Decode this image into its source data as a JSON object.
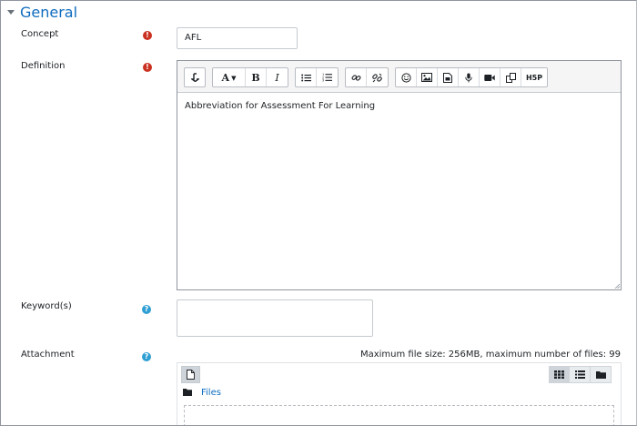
{
  "section": {
    "title": "General"
  },
  "fields": {
    "concept": {
      "label": "Concept",
      "value": "AFL"
    },
    "definition": {
      "label": "Definition",
      "content": "Abbreviation for Assessment For Learning"
    },
    "keywords": {
      "label": "Keyword(s)",
      "value": ""
    },
    "attachment": {
      "label": "Attachment",
      "max_info": "Maximum file size: 256MB, maximum number of files: 99",
      "path_label": "Files"
    }
  },
  "editor_toolbar": {
    "h5p_label": "H5P"
  },
  "colors": {
    "link_blue": "#0f6cbf",
    "required_red": "#ca3120",
    "help_blue": "#2f9fd3"
  },
  "icons": {
    "required": "exclamation-circle",
    "help": "question-circle"
  }
}
